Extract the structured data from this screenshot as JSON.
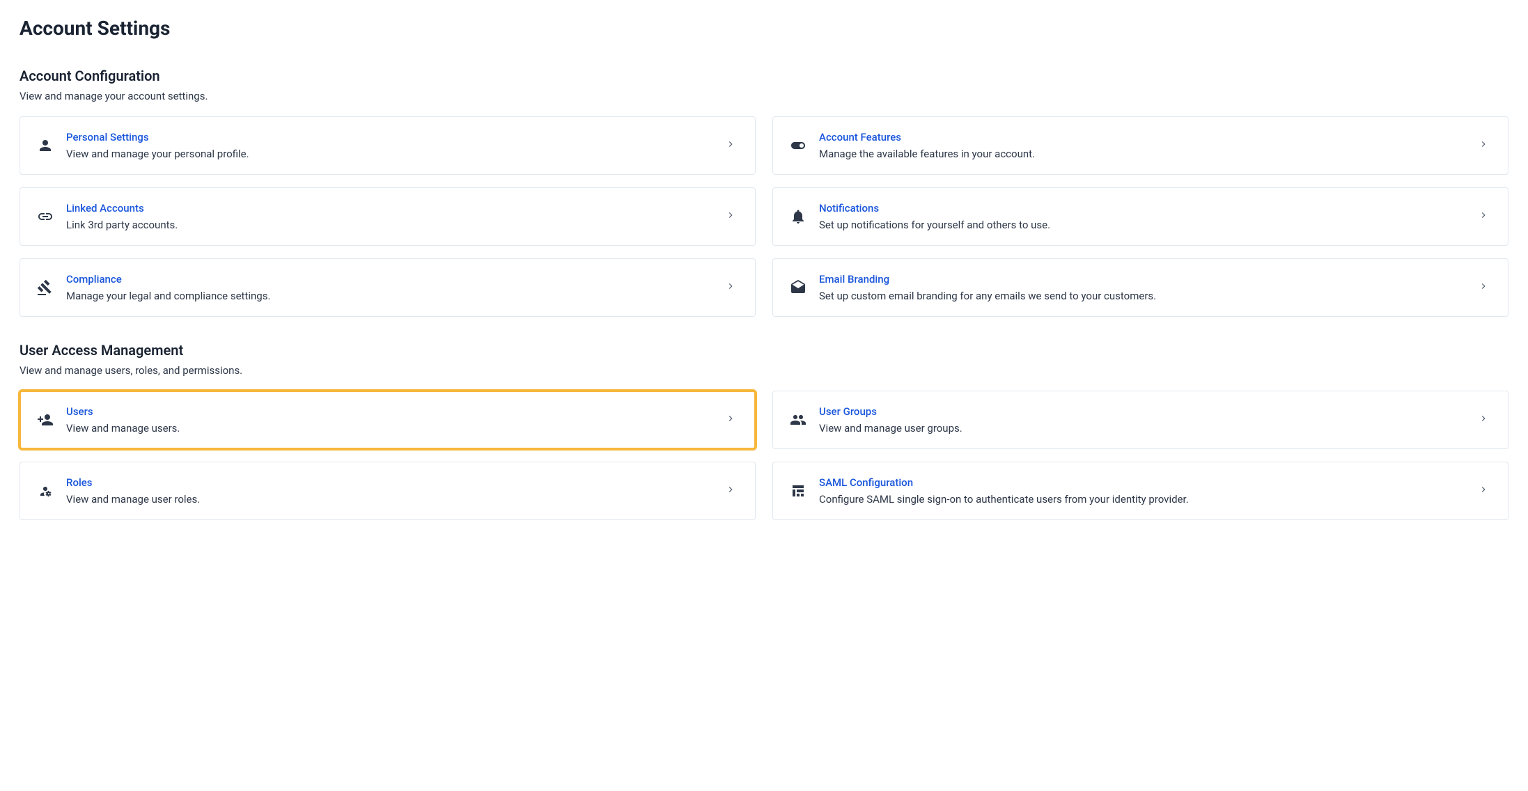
{
  "page": {
    "title": "Account Settings"
  },
  "sections": [
    {
      "title": "Account Configuration",
      "desc": "View and manage your account settings.",
      "cards": [
        {
          "icon": "person-icon",
          "title": "Personal Settings",
          "desc": "View and manage your personal profile.",
          "highlight": false
        },
        {
          "icon": "toggle-icon",
          "title": "Account Features",
          "desc": "Manage the available features in your account.",
          "highlight": false
        },
        {
          "icon": "link-icon",
          "title": "Linked Accounts",
          "desc": "Link 3rd party accounts.",
          "highlight": false
        },
        {
          "icon": "bell-icon",
          "title": "Notifications",
          "desc": "Set up notifications for yourself and others to use.",
          "highlight": false
        },
        {
          "icon": "gavel-icon",
          "title": "Compliance",
          "desc": "Manage your legal and compliance settings.",
          "highlight": false
        },
        {
          "icon": "mail-open-icon",
          "title": "Email Branding",
          "desc": "Set up custom email branding for any emails we send to your customers.",
          "highlight": false
        }
      ]
    },
    {
      "title": "User Access Management",
      "desc": "View and manage users, roles, and permissions.",
      "cards": [
        {
          "icon": "user-plus-icon",
          "title": "Users",
          "desc": "View and manage users.",
          "highlight": true
        },
        {
          "icon": "users-icon",
          "title": "User Groups",
          "desc": "View and manage user groups.",
          "highlight": false
        },
        {
          "icon": "users-cog-icon",
          "title": "Roles",
          "desc": "View and manage user roles.",
          "highlight": false
        },
        {
          "icon": "saml-icon",
          "title": "SAML Configuration",
          "desc": "Configure SAML single sign-on to authenticate users from your identity provider.",
          "highlight": false
        }
      ]
    }
  ]
}
